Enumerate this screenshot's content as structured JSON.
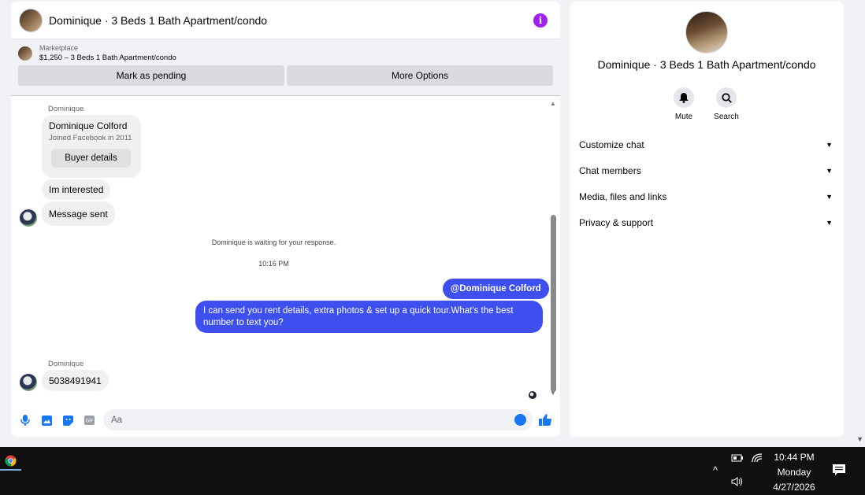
{
  "chat": {
    "title": "Dominique · 3 Beds 1 Bath Apartment/condo",
    "info_icon": "i",
    "marketplace": {
      "label": "Marketplace",
      "listing": "$1,250 – 3 Beds 1 Bath Apartment/condo",
      "pending_button": "Mark as pending",
      "options_button": "More Options"
    },
    "card": {
      "sender": "Dominique",
      "name": "Dominique Colford",
      "joined": "Joined Facebook in 2011",
      "button": "Buyer details"
    },
    "messages": {
      "in1": "Im interested",
      "in2": "Message sent",
      "waiting": "Dominique is waiting for your response.",
      "time": "10:16 PM",
      "mention": "@Dominique Colford",
      "out": "I can send you rent details, extra photos & set up a quick tour.What's the best number to text you?",
      "sender2": "Dominique",
      "in3": "5038491941"
    },
    "composer_placeholder": "Aa",
    "colors": {
      "outgoing": "#3e4ff0",
      "accent": "#1877f2",
      "info": "#a020f0"
    }
  },
  "panel": {
    "title": "Dominique · 3 Beds 1 Bath Apartment/condo",
    "mute": "Mute",
    "search": "Search",
    "sections": [
      "Customize chat",
      "Chat members",
      "Media, files and links",
      "Privacy & support"
    ]
  },
  "taskbar": {
    "time": "10:44 PM",
    "day": "Monday",
    "date": "4/27/2026"
  }
}
